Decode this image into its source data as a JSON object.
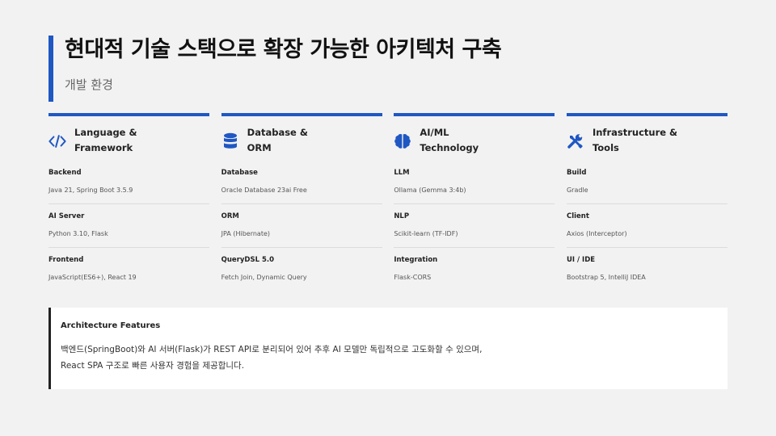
{
  "header": {
    "title": "현대적 기술 스택으로 확장 가능한 아키텍처 구축",
    "subtitle": "개발 환경"
  },
  "colors": {
    "accent": "#1f57c3",
    "features_border": "#222222"
  },
  "columns": [
    {
      "icon": "code-icon",
      "title_line1": "Language &",
      "title_line2": "Framework",
      "items": [
        {
          "label": "Backend",
          "value": "Java 21, Spring Boot 3.5.9"
        },
        {
          "label": "AI Server",
          "value": "Python 3.10, Flask"
        },
        {
          "label": "Frontend",
          "value": "JavaScript(ES6+), React 19"
        }
      ]
    },
    {
      "icon": "database-icon",
      "title_line1": "Database &",
      "title_line2": "ORM",
      "items": [
        {
          "label": "Database",
          "value": "Oracle Database 23ai Free"
        },
        {
          "label": "ORM",
          "value": "JPA (Hibernate)"
        },
        {
          "label": "QueryDSL 5.0",
          "value": "Fetch Join, Dynamic Query"
        }
      ]
    },
    {
      "icon": "brain-icon",
      "title_line1": "AI/ML",
      "title_line2": "Technology",
      "items": [
        {
          "label": "LLM",
          "value": "Ollama (Gemma 3:4b)"
        },
        {
          "label": "NLP",
          "value": "Scikit-learn (TF-IDF)"
        },
        {
          "label": "Integration",
          "value": "Flask-CORS"
        }
      ]
    },
    {
      "icon": "tools-icon",
      "title_line1": "Infrastructure &",
      "title_line2": "Tools",
      "items": [
        {
          "label": "Build",
          "value": "Gradle"
        },
        {
          "label": "Client",
          "value": "Axios (Interceptor)"
        },
        {
          "label": "UI / IDE",
          "value": "Bootstrap 5, IntelliJ IDEA"
        }
      ]
    }
  ],
  "features": {
    "title": "Architecture Features",
    "line1": "백엔드(SpringBoot)와 AI 서버(Flask)가 REST API로 분리되어 있어 추후 AI 모델만 독립적으로 고도화할 수 있으며,",
    "line2": " React SPA 구조로 빠른 사용자 경험을 제공합니다."
  }
}
